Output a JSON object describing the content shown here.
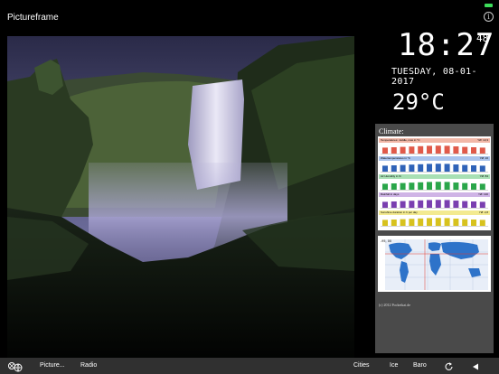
{
  "status": {
    "battery_color": "#3ddc5a"
  },
  "header": {
    "title": "Pictureframe",
    "info_icon": "info-icon",
    "info_glyph": "i"
  },
  "clock": {
    "time": "18:27",
    "seconds": "48",
    "date": "TUESDAY, 08-01-2017",
    "temperature": "29°C"
  },
  "climate": {
    "title": "Climate:",
    "charts": [
      {
        "label": "Temperatures: middle, max in °C",
        "year": "YØ: 13,3",
        "color": "#e05a4a",
        "head_bg": "#f2b8a8"
      },
      {
        "label": "Watertemperatures in °C",
        "year": "YØ: 16",
        "color": "#2f63b8",
        "head_bg": "#a9c3ec"
      },
      {
        "label": "Air Humidity in %",
        "year": "YØ: 84",
        "color": "#2aa64a",
        "head_bg": "#a8e0b4"
      },
      {
        "label": "Rainfall in days",
        "year": "YØ: 130",
        "color": "#7a3fb0",
        "head_bg": "#cfb4e6"
      },
      {
        "label": "Sunshine duration in h per day",
        "year": "YØ: 2,8",
        "color": "#d7c21e",
        "head_bg": "#f3ea90"
      }
    ],
    "map_label": "-95, 00",
    "copyright": "(c) 2012 Pocketkai.de"
  },
  "toolbar": {
    "left_icon": "settings-globe-icon",
    "picture_label": "Picture...",
    "radio_label": "Radio",
    "cities_label": "Cities",
    "ice_label": "Ice",
    "baro_label": "Baro",
    "refresh_icon": "refresh-icon",
    "back_icon": "back-arrow-icon"
  }
}
